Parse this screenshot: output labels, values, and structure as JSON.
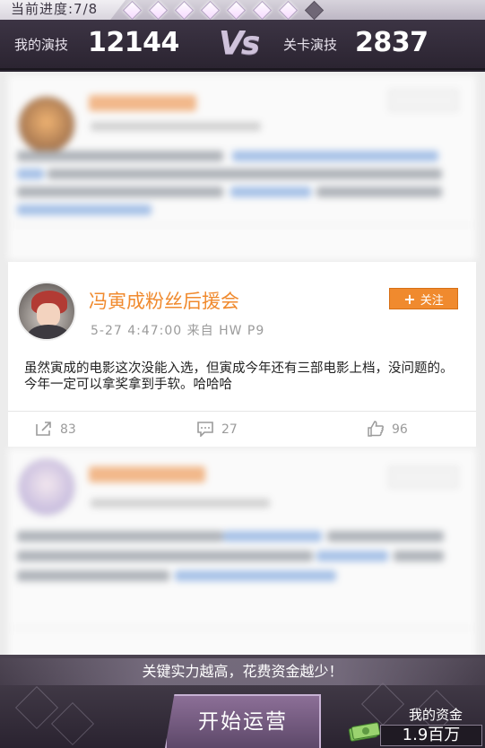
{
  "progress": {
    "label": "当前进度:7/8",
    "current": 7,
    "total": 8
  },
  "versus": {
    "my_label": "我的演技",
    "my_value": "12144",
    "vs_text": "VS",
    "level_label": "关卡演技",
    "level_value": "2837"
  },
  "feed": {
    "featured_post": {
      "author": "冯寅成粉丝后援会",
      "meta": "5-27  4:47:00 来自 HW P9",
      "follow_label": "关注",
      "content": "虽然寅成的电影这次没能入选，但寅成今年还有三部电影上档，没问题的。今年一定可以拿奖拿到手软。哈哈哈",
      "shares": "83",
      "comments": "27",
      "likes": "96"
    }
  },
  "bottom": {
    "hint": "关键实力越高，花费资金越少！",
    "start_button": "开始运营",
    "money_label": "我的资金",
    "money_value": "1.9百万"
  },
  "colors": {
    "accent_orange": "#f08a2e",
    "header_bg": "#2b2431",
    "button_purple": "#6f5a7b"
  },
  "icons": [
    "share-icon",
    "comment-icon",
    "like-icon",
    "money-icon",
    "plus-icon"
  ]
}
